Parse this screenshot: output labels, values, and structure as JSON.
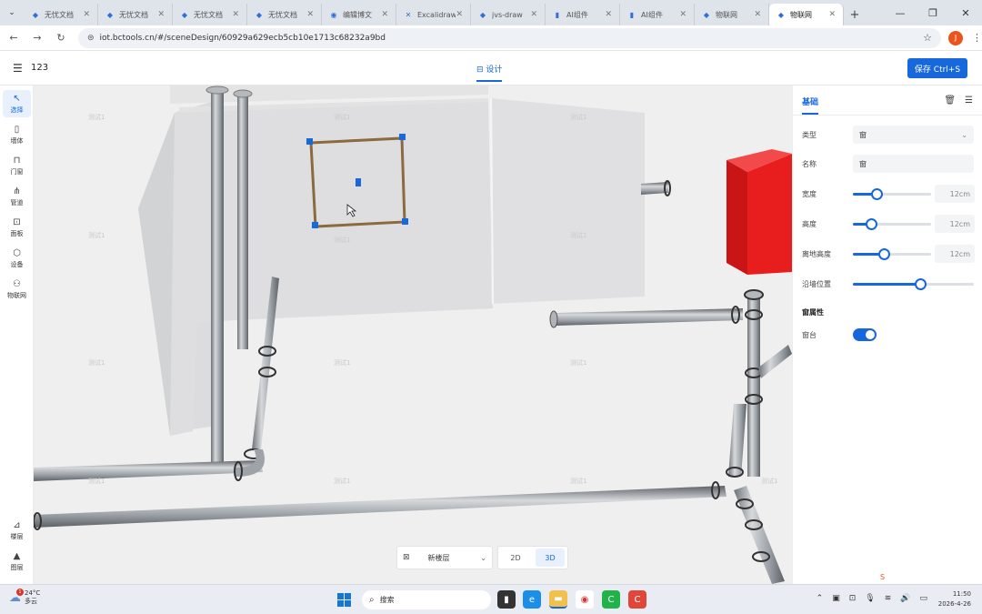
{
  "browser": {
    "tabs": [
      {
        "label": "无忧文档",
        "icon": "◆"
      },
      {
        "label": "无忧文档",
        "icon": "◆"
      },
      {
        "label": "无忧文档",
        "icon": "◆"
      },
      {
        "label": "无忧文档",
        "icon": "◆"
      },
      {
        "label": "编辑博文",
        "icon": "◉"
      },
      {
        "label": "Excalidraw",
        "icon": "✕"
      },
      {
        "label": "jvs-draw",
        "icon": "◆"
      },
      {
        "label": "AI组件",
        "icon": "▮"
      },
      {
        "label": "AI组件",
        "icon": "▮"
      },
      {
        "label": "物联网",
        "icon": "◆"
      },
      {
        "label": "物联网",
        "icon": "◆"
      }
    ],
    "url": "iot.bctools.cn/#/sceneDesign/60929a629ecb5cb10e1713c68232a9bd",
    "profile_initial": "J"
  },
  "app": {
    "project_name": "123",
    "design_tab": "设计",
    "save_button": "保存 Ctrl+S"
  },
  "left_tools": [
    {
      "label": "选择",
      "icon": "↖",
      "active": true
    },
    {
      "label": "墙体",
      "icon": "▯"
    },
    {
      "label": "门窗",
      "icon": "⊓"
    },
    {
      "label": "管道",
      "icon": "⋔"
    },
    {
      "label": "面板",
      "icon": "⊡"
    },
    {
      "label": "设备",
      "icon": "⬡"
    },
    {
      "label": "物联网",
      "icon": "⚇"
    }
  ],
  "left_bottom_tools": [
    {
      "label": "楼层",
      "icon": "⊿"
    },
    {
      "label": "图层",
      "icon": "▲"
    }
  ],
  "viewport": {
    "watermark": "测试1",
    "layer_select": "新楼层",
    "view_2d": "2D",
    "view_3d": "3D"
  },
  "panel": {
    "tab": "基础",
    "type_label": "类型",
    "type_value": "窗",
    "name_label": "名称",
    "name_value": "窗",
    "width_label": "宽度",
    "width_value": "12cm",
    "width_fraction": 0.3,
    "height_label": "高度",
    "height_value": "12cm",
    "height_fraction": 0.23,
    "floor_height_label": "离地高度",
    "floor_height_value": "12cm",
    "floor_height_fraction": 0.4,
    "wall_pos_label": "沿墙位置",
    "wall_pos_fraction": 0.56,
    "window_attr_label": "窗属性",
    "sill_label": "窗台",
    "sill_on": true,
    "csdn_badge": "S"
  },
  "taskbar": {
    "temp": "24°C",
    "weather": "多云",
    "weather_badge": "1",
    "search": "搜索",
    "time": "11:50",
    "date": "2026-4-26"
  }
}
